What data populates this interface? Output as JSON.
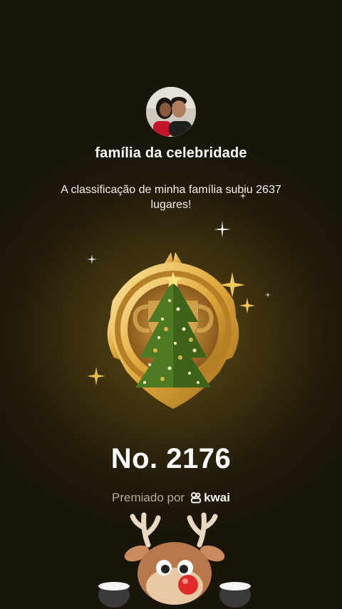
{
  "profile": {
    "avatar_icon": "family-photo-avatar"
  },
  "family_name": "família da celebridade",
  "message": "A classificação de minha família subiu 2637 lugares!",
  "badge": {
    "icon": "christmas-tree-trophy-badge"
  },
  "rank": "No. 2176",
  "awarded_by": {
    "label": "Premiado por",
    "brand": "kwai"
  },
  "decoration": {
    "icon": "reindeer-icon"
  },
  "colors": {
    "gold": "#e6b64a",
    "background": "#2a210c",
    "muted_text": "#b5ac98"
  }
}
